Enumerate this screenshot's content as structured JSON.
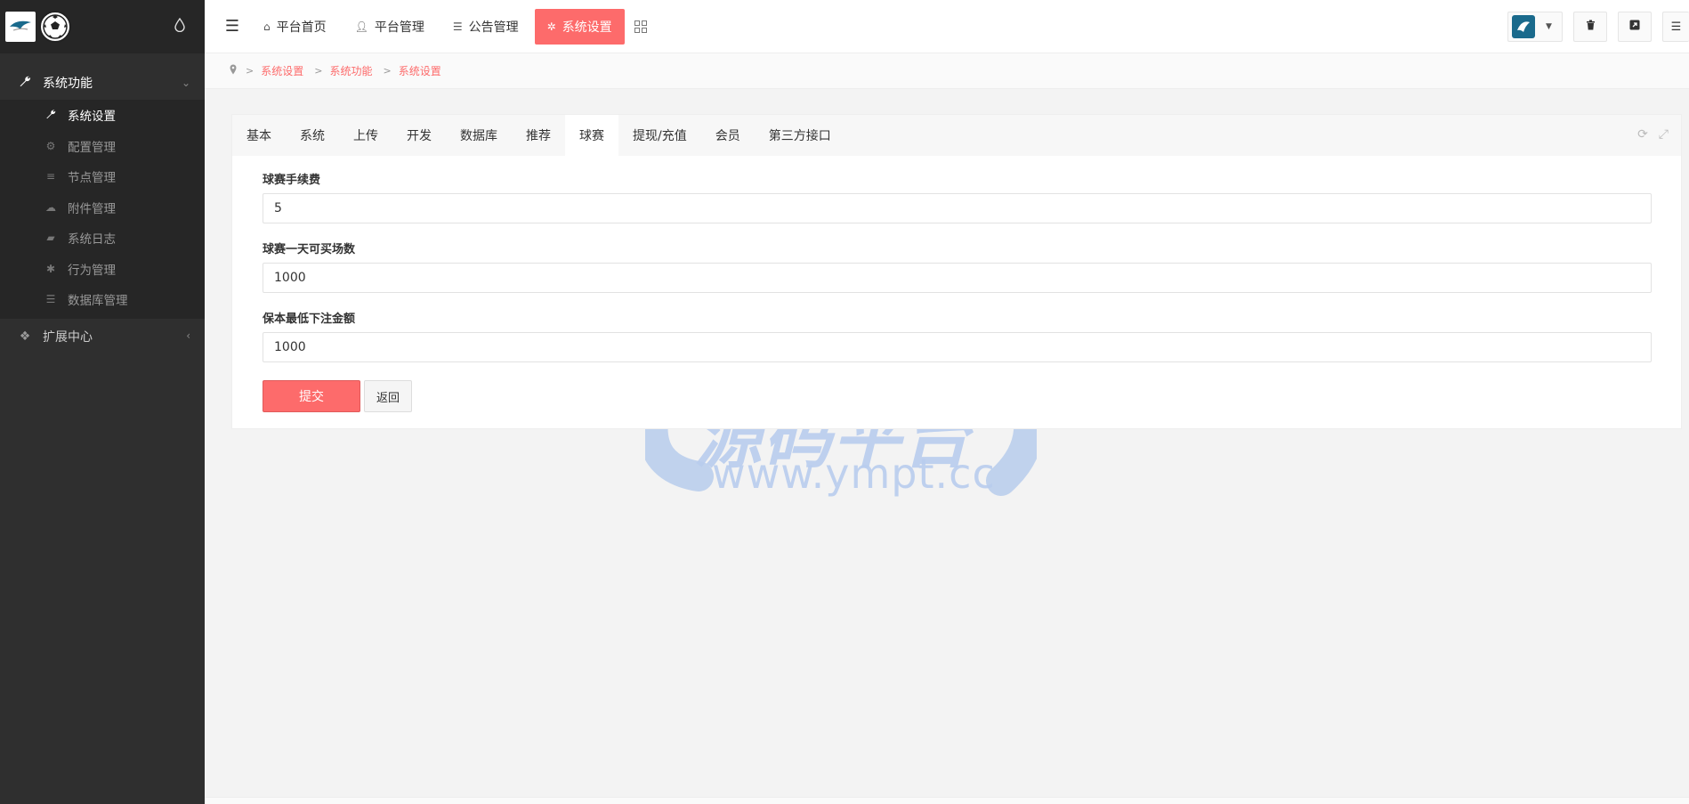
{
  "sidebar": {
    "group_title": "系统功能",
    "items": [
      {
        "label": "系统设置",
        "icon": "wrench-icon"
      },
      {
        "label": "配置管理",
        "icon": "cogs-icon"
      },
      {
        "label": "节点管理",
        "icon": "list-icon"
      },
      {
        "label": "附件管理",
        "icon": "cloud-icon"
      },
      {
        "label": "系统日志",
        "icon": "book-icon"
      },
      {
        "label": "行为管理",
        "icon": "bug-icon"
      },
      {
        "label": "数据库管理",
        "icon": "database-icon"
      }
    ],
    "ext_title": "扩展中心"
  },
  "topnav": {
    "items": [
      {
        "label": "平台首页",
        "icon": "home-icon"
      },
      {
        "label": "平台管理",
        "icon": "user-icon"
      },
      {
        "label": "公告管理",
        "icon": "list-icon"
      },
      {
        "label": "系统设置",
        "icon": "gear-icon"
      }
    ],
    "active_color": "#fd6b6b"
  },
  "breadcrumb": [
    "系统设置",
    "系统功能",
    "系统设置"
  ],
  "tabs": [
    "基本",
    "系统",
    "上传",
    "开发",
    "数据库",
    "推荐",
    "球赛",
    "提现/充值",
    "会员",
    "第三方接口"
  ],
  "active_tab": "球赛",
  "form": {
    "fields": [
      {
        "label": "球赛手续费",
        "value": "5"
      },
      {
        "label": "球赛一天可买场数",
        "value": "1000"
      },
      {
        "label": "保本最低下注金额",
        "value": "1000"
      }
    ],
    "submit_label": "提交",
    "back_label": "返回"
  },
  "watermark": {
    "title": "源码平台",
    "url": "www.ympt.cc"
  }
}
